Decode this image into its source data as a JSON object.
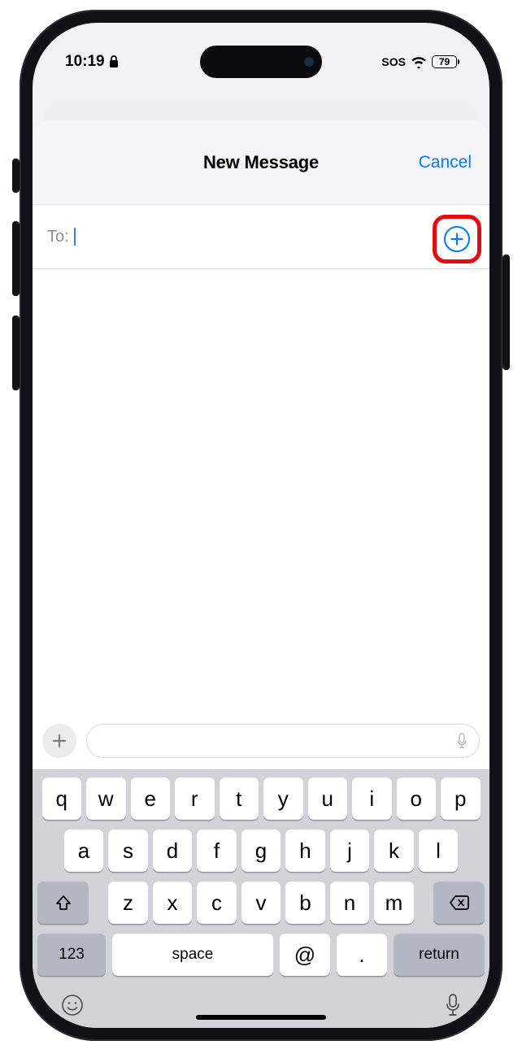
{
  "status_bar": {
    "time": "10:19",
    "sos_label": "SOS",
    "battery_pct": "79"
  },
  "sheet": {
    "title": "New Message",
    "cancel_label": "Cancel",
    "to_label": "To:"
  },
  "keyboard": {
    "row1": [
      "q",
      "w",
      "e",
      "r",
      "t",
      "y",
      "u",
      "i",
      "o",
      "p"
    ],
    "row2": [
      "a",
      "s",
      "d",
      "f",
      "g",
      "h",
      "j",
      "k",
      "l"
    ],
    "row3": [
      "z",
      "x",
      "c",
      "v",
      "b",
      "n",
      "m"
    ],
    "numbers_label": "123",
    "space_label": "space",
    "at_label": "@",
    "dot_label": ".",
    "return_label": "return"
  }
}
